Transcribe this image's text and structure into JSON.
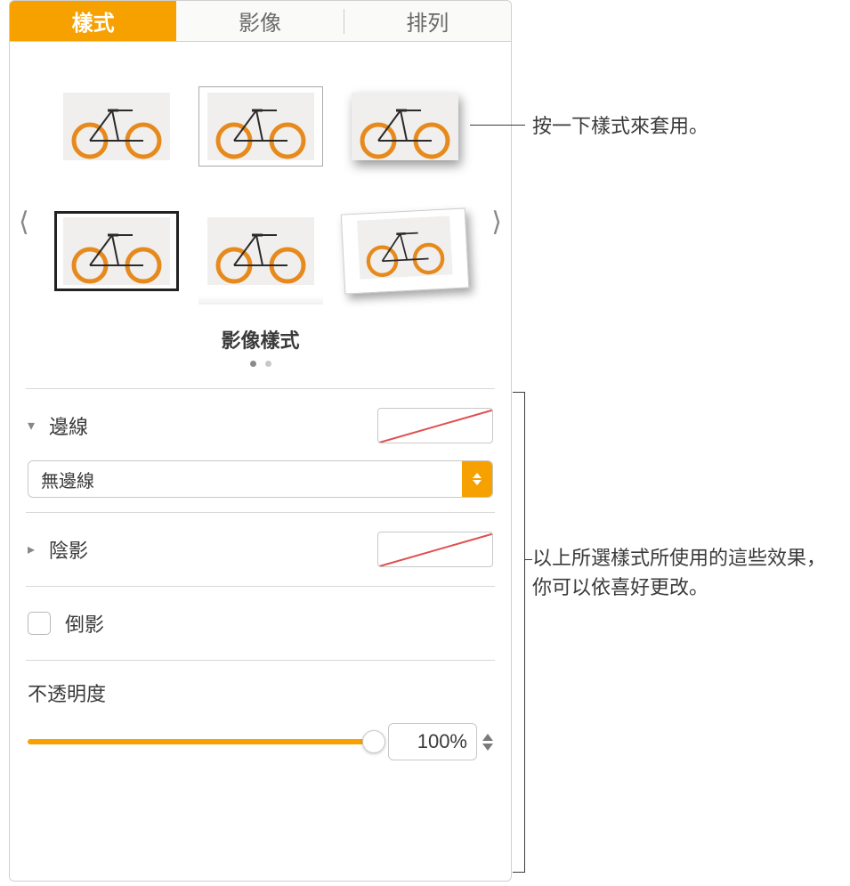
{
  "tabs": {
    "style": "樣式",
    "image": "影像",
    "arrange": "排列"
  },
  "styles": {
    "title": "影像樣式",
    "page_index": 0,
    "page_count": 2
  },
  "border": {
    "label": "邊線",
    "select_value": "無邊線",
    "swatch": "none"
  },
  "shadow": {
    "label": "陰影",
    "swatch": "none"
  },
  "reflection": {
    "label": "倒影",
    "checked": false
  },
  "opacity": {
    "label": "不透明度",
    "value": "100%",
    "percent": 100
  },
  "callouts": {
    "c1": "按一下樣式來套用。",
    "c2": "以上所選樣式所使用的這些效果，你可以依喜好更改。"
  }
}
